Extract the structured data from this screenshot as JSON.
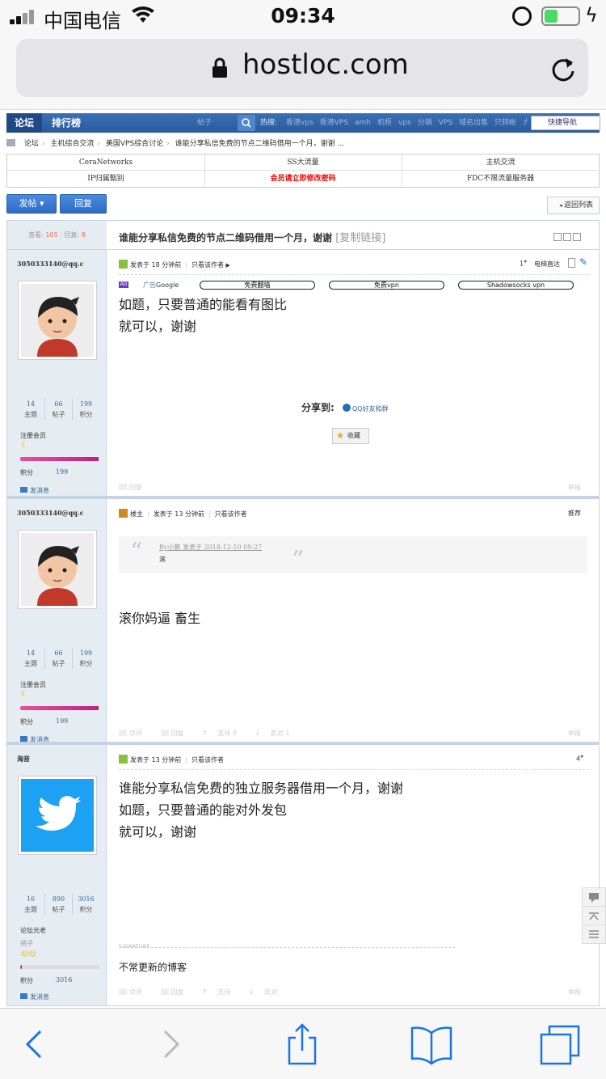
{
  "status_bar": {
    "carrier": "中国电信",
    "time": "09:34",
    "battery_level": 0.4
  },
  "browser": {
    "url": "hostloc.com"
  },
  "forum_nav": {
    "tabs": [
      "论坛",
      "排行榜"
    ],
    "search_scope": "帖子",
    "hot_label": "热搜:",
    "hot_terms": [
      "香港vps",
      "香港VPS",
      "amh",
      "机柜",
      "vps",
      "分销",
      "VPS",
      "域名出售",
      "只转帐",
      "大东宝"
    ],
    "quick_nav": "快捷导航"
  },
  "breadcrumb": [
    "论坛",
    "主机综合交流",
    "美国VPS综合讨论",
    "谁能分享私信免费的节点二维码借用一个月，谢谢 ..."
  ],
  "link_table": [
    [
      "CeraNetworks",
      "SS大流量",
      "主机交流"
    ],
    [
      "IP归属甄别",
      "会员请立即修改密码",
      "FDC不限流量服务器"
    ]
  ],
  "actions": {
    "post": "发帖",
    "reply": "回复",
    "back": "返回列表"
  },
  "thread": {
    "views_label": "查看:",
    "views": "105",
    "replies_label": "回复:",
    "replies": "8",
    "title": "谁能分享私信免费的节点二维码借用一个月，谢谢",
    "copy_link": "[复制链接]"
  },
  "posts": [
    {
      "author": "3050333140@qq.c",
      "stats": [
        {
          "value": "14",
          "label": "主题"
        },
        {
          "value": "66",
          "label": "帖子"
        },
        {
          "value": "199",
          "label": "积分"
        }
      ],
      "rank": "注册会员",
      "rank_progress": 0.99,
      "credit_label": "积分",
      "credit": "199",
      "send_msg": "发消息",
      "time": "发表于 18 分钟前",
      "only_author": "只看该作者",
      "floor": "1",
      "floor_sup": "#",
      "elevator": "电梯直达",
      "ad": {
        "badge": "AD",
        "label": "广告",
        "brand": "Google",
        "pills": [
          "免费翻墙",
          "免费vpn",
          "Shadowsocks vpn"
        ]
      },
      "body": [
        "如题，只要普通的能看有图比",
        "就可以，谢谢"
      ],
      "share_label": "分享到:",
      "share_target": "QQ好友和群",
      "favorite": "收藏",
      "footer": {
        "reply": "回复",
        "report": "举报"
      }
    },
    {
      "author": "3050333140@qq.c",
      "stats": [
        {
          "value": "14",
          "label": "主题"
        },
        {
          "value": "66",
          "label": "帖子"
        },
        {
          "value": "199",
          "label": "积分"
        }
      ],
      "rank": "注册会员",
      "rank_progress": 0.99,
      "credit_label": "积分",
      "credit": "199",
      "send_msg": "发消息",
      "host_label": "楼主",
      "time": "发表于 13 分钟前",
      "only_author": "只看该作者",
      "recommend": "推荐",
      "quote": {
        "line1": "By小鹏 发表于 2018-12-10 09:27",
        "line2": "滚"
      },
      "body": [
        "滚你妈逼 畜生"
      ],
      "footer": {
        "rate": "点评",
        "reply": "回复",
        "support": "支持 0",
        "oppose": "反对 1",
        "report": "举报"
      }
    },
    {
      "author": "海音",
      "stats": [
        {
          "value": "16",
          "label": "主题"
        },
        {
          "value": "890",
          "label": "帖子"
        },
        {
          "value": "3016",
          "label": "积分"
        }
      ],
      "rank": "论坛元老",
      "rank_sub": "鸽子",
      "rank_progress": 0.02,
      "credit_label": "积分",
      "credit": "3016",
      "send_msg": "发消息",
      "time": "发表于 13 分钟前",
      "only_author": "只看该作者",
      "floor": "4",
      "floor_sup": "#",
      "body": [
        "谁能分享私信免费的独立服务器借用一个月，谢谢",
        "如题，只要普通的能对外发包",
        "就可以，谢谢"
      ],
      "signature_label": "SIGNATURE",
      "signature": "不常更新的博客",
      "footer": {
        "rate": "点评",
        "reply": "回复",
        "support": "支持",
        "oppose": "反对",
        "report": "举报"
      }
    }
  ]
}
